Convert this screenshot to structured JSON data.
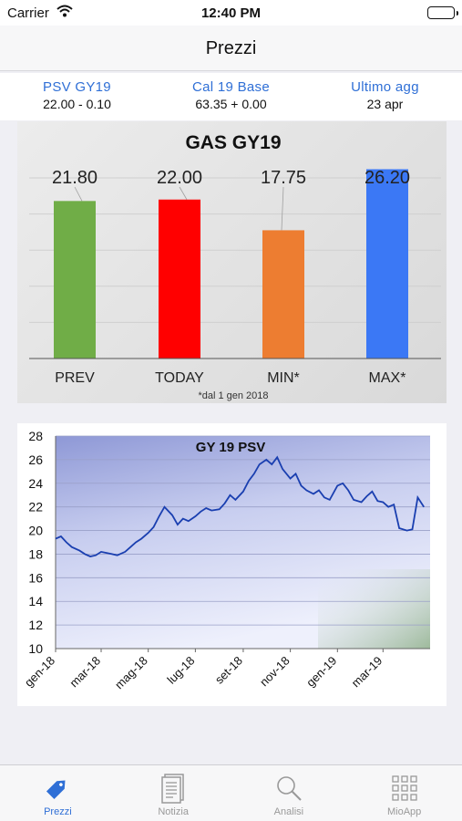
{
  "status_bar": {
    "carrier": "Carrier",
    "time": "12:40 PM"
  },
  "nav": {
    "title": "Prezzi"
  },
  "summary": [
    {
      "label": "PSV GY19",
      "value": "22.00 - 0.10"
    },
    {
      "label": "Cal 19 Base",
      "value": "63.35 + 0.00"
    },
    {
      "label": "Ultimo agg",
      "value": "23 apr"
    }
  ],
  "chart_data": [
    {
      "type": "bar",
      "title": "GAS GY19",
      "categories": [
        "PREV",
        "TODAY",
        "MIN*",
        "MAX*"
      ],
      "values": [
        21.8,
        22.0,
        17.75,
        26.2
      ],
      "value_labels": [
        "21.80",
        "22.00",
        "17.75",
        "26.20"
      ],
      "colors": [
        "#70ad47",
        "#ff0000",
        "#ed7d31",
        "#3b78f5"
      ],
      "footnote": "*dal 1 gen 2018",
      "ylim": [
        0,
        27
      ],
      "grid": true
    },
    {
      "type": "line",
      "title": "GY 19 PSV",
      "x_ticks": [
        "gen-18",
        "mar-18",
        "mag-18",
        "lug-18",
        "set-18",
        "nov-18",
        "gen-19",
        "mar-19"
      ],
      "y_ticks": [
        "10",
        "12",
        "14",
        "16",
        "18",
        "20",
        "22",
        "24",
        "26",
        "28"
      ],
      "ylim": [
        10,
        28
      ],
      "grid": true,
      "series": [
        {
          "color": "#1a3fb0",
          "x": [
            "2018-01-01",
            "2018-01-08",
            "2018-01-15",
            "2018-01-22",
            "2018-02-01",
            "2018-02-08",
            "2018-02-15",
            "2018-02-22",
            "2018-03-01",
            "2018-03-08",
            "2018-03-15",
            "2018-03-22",
            "2018-04-01",
            "2018-04-08",
            "2018-04-15",
            "2018-04-22",
            "2018-05-01",
            "2018-05-08",
            "2018-05-15",
            "2018-05-22",
            "2018-06-01",
            "2018-06-08",
            "2018-06-15",
            "2018-06-22",
            "2018-07-01",
            "2018-07-08",
            "2018-07-15",
            "2018-07-22",
            "2018-08-01",
            "2018-08-08",
            "2018-08-15",
            "2018-08-22",
            "2018-09-01",
            "2018-09-08",
            "2018-09-15",
            "2018-09-22",
            "2018-10-01",
            "2018-10-08",
            "2018-10-15",
            "2018-10-22",
            "2018-11-01",
            "2018-11-08",
            "2018-11-15",
            "2018-11-22",
            "2018-12-01",
            "2018-12-08",
            "2018-12-15",
            "2018-12-22",
            "2019-01-01",
            "2019-01-08",
            "2019-01-15",
            "2019-01-22",
            "2019-02-01",
            "2019-02-08",
            "2019-02-15",
            "2019-02-22",
            "2019-03-01",
            "2019-03-08",
            "2019-03-15",
            "2019-03-22",
            "2019-04-01",
            "2019-04-08",
            "2019-04-15",
            "2019-04-23"
          ],
          "y": [
            19.3,
            19.5,
            19.0,
            18.6,
            18.3,
            18.0,
            17.8,
            17.9,
            18.2,
            18.1,
            18.0,
            17.9,
            18.2,
            18.6,
            19.0,
            19.3,
            19.8,
            20.3,
            21.2,
            22.0,
            21.3,
            20.5,
            21.0,
            20.8,
            21.2,
            21.6,
            21.9,
            21.7,
            21.8,
            22.3,
            23.0,
            22.6,
            23.3,
            24.2,
            24.8,
            25.6,
            26.0,
            25.6,
            26.2,
            25.2,
            24.4,
            24.8,
            23.8,
            23.4,
            23.1,
            23.4,
            22.8,
            22.6,
            23.8,
            24.0,
            23.4,
            22.6,
            22.4,
            22.9,
            23.3,
            22.5,
            22.4,
            22.0,
            22.2,
            20.2,
            20.0,
            20.1,
            22.8,
            22.0
          ]
        }
      ]
    }
  ],
  "tabs": [
    {
      "label": "Prezzi",
      "icon": "tag-icon"
    },
    {
      "label": "Notizia",
      "icon": "document-icon"
    },
    {
      "label": "Analisi",
      "icon": "magnifier-icon"
    },
    {
      "label": "MioApp",
      "icon": "grid-icon"
    }
  ],
  "colors": {
    "accent": "#2f6fd6",
    "tab_inactive": "#999999"
  }
}
